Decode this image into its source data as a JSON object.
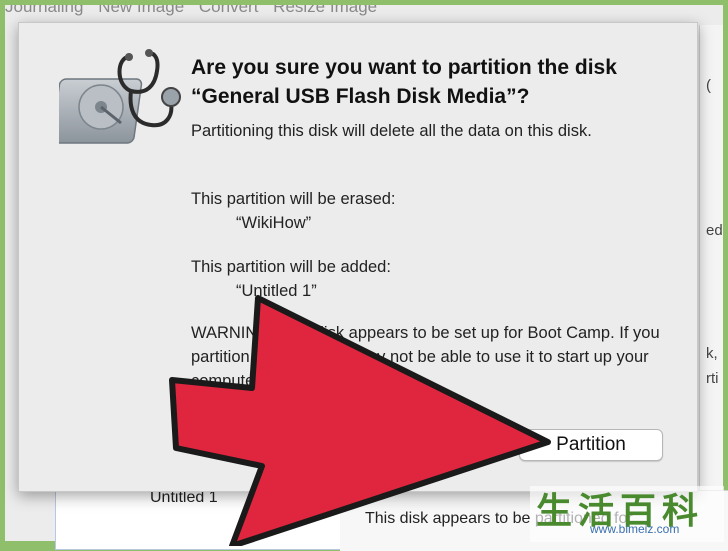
{
  "background_window": {
    "toolbar_items": [
      "Journaling",
      "New Image",
      "Convert",
      "Resize Image"
    ],
    "right_column_rows": [
      "(",
      "ed)",
      "k,",
      "rti"
    ],
    "sidebar_item": "Untitled 1",
    "bottom_text": "This disk appears to be partitioned for..."
  },
  "dialog": {
    "icon": "disk-utility-stethoscope-icon",
    "title": "Are you sure you want to partition the disk “General USB Flash Disk Media”?",
    "delete_warning": "Partitioning this disk will delete all the data on this disk.",
    "erased_label": "This partition will be erased:",
    "erased_name": "“WikiHow”",
    "added_label": "This partition will be added:",
    "added_name": "“Untitled 1”",
    "bootcamp_warning": "WARNING: This disk appears to be set up for Boot Camp. If you partition this disk, you may not be able to use it to start up your computer in Windows.",
    "partition_button": "Partition"
  },
  "overlay": {
    "arrow_color": "#e0263e",
    "arrow_icon": "pointing-arrow-icon"
  },
  "watermark": {
    "chinese": "生活百科",
    "url": "www.bimeiz.com"
  }
}
